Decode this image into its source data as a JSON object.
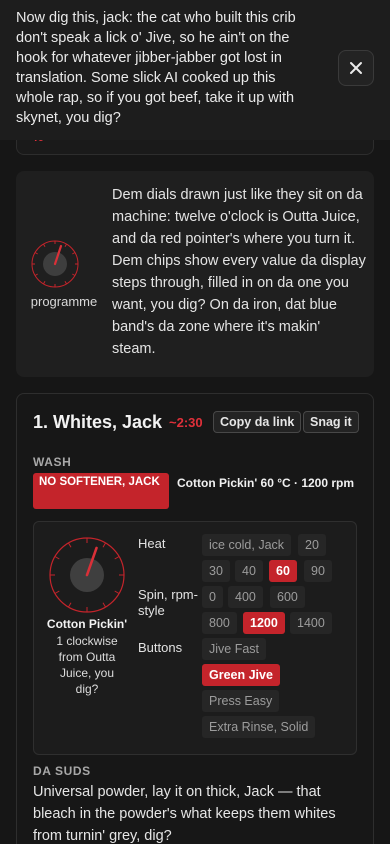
{
  "banner": {
    "text": "Now dig this, jack: the cat who built this crib don't speak a lick o' Jive, so he ain't on the hook for whatever jibber-jabber got lost in translation. Some slick AI cooked up this whole rap, so if you got beef, take it up with skynet, you dig?",
    "close_icon": "close-icon"
  },
  "partial": {
    "value": "40"
  },
  "info": {
    "dial_label": "programme",
    "text": "Dem dials drawn just like they sit on da machine: twelve o'clock is Outta Juice, and da red pointer's where you turn it. Dem chips show every value da display steps through, filled in on da one you want, you dig? On da iron, dat blue band's da zone where it's makin' steam."
  },
  "program": {
    "title": "1. Whites, Jack",
    "time": "~2:30",
    "copy_link": "Copy da link",
    "snag_it": "Snag it",
    "wash_label": "WASH",
    "warning": "NO SOFTENER, JACK",
    "summary": "Cotton Pickin' 60 °C · 1200 rpm",
    "dial_name": "Cotton Pickin'",
    "dial_desc": "1 clockwise from Outta Juice, you dig?",
    "heat_label": "Heat",
    "spin_label": "Spin, rpm-style",
    "buttons_label": "Buttons",
    "heat_options": [
      "ice cold, Jack",
      "20",
      "30",
      "40",
      "60",
      "90"
    ],
    "heat_selected": "60",
    "spin_options": [
      "0",
      "400",
      "600",
      "800",
      "1200",
      "1400"
    ],
    "spin_selected": "1200",
    "button_options": [
      "Jive Fast",
      "Green Jive",
      "Press Easy",
      "Extra Rinse, Solid"
    ],
    "button_selected": "Green Jive",
    "suds_label": "DA SUDS",
    "suds_text": "Universal powder, lay it on thick, Jack — that bleach in the powder's what keeps them whites from turnin' grey, dig?"
  },
  "colors": {
    "accent": "#c4242b",
    "accent_text": "#e0303a",
    "background": "#161616"
  }
}
